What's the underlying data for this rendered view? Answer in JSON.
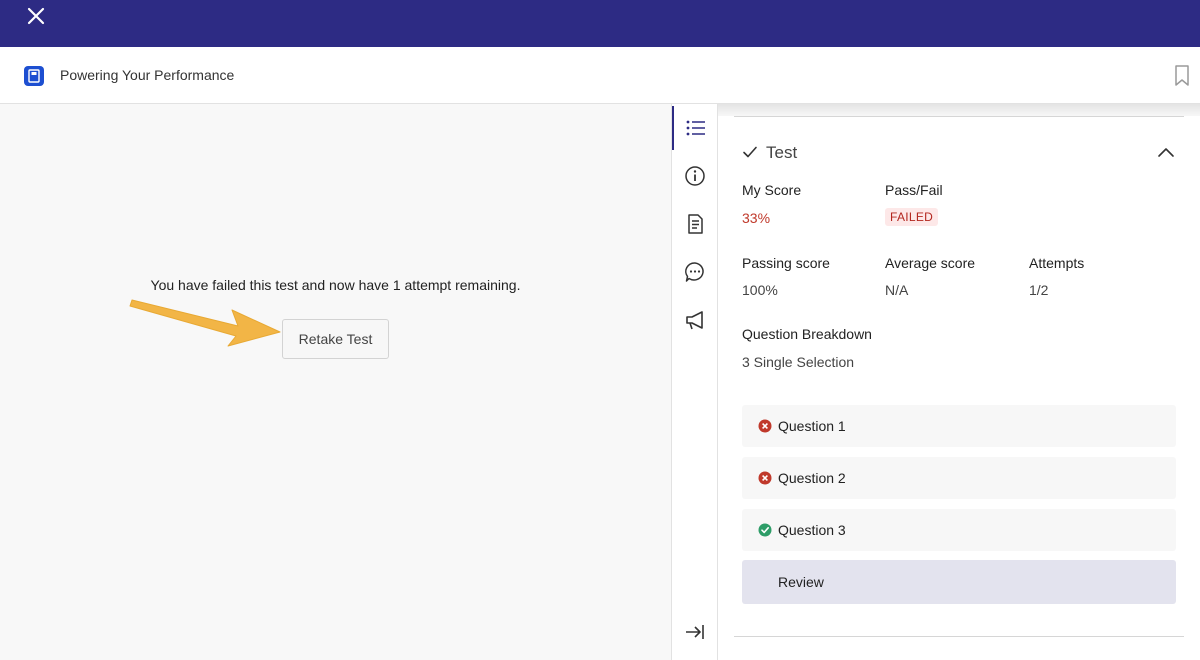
{
  "topbar": {
    "close_icon": "close-icon",
    "color": "#2d2b84"
  },
  "header": {
    "app_icon": "book-icon",
    "title": "Powering Your Performance",
    "bookmark_icon": "bookmark-icon"
  },
  "main": {
    "message": "You have failed this test and now have 1 attempt remaining.",
    "retake_label": "Retake Test",
    "arrow_color": "#f2b546"
  },
  "rail": {
    "items": [
      {
        "icon": "list-icon"
      },
      {
        "icon": "info-icon"
      },
      {
        "icon": "document-icon"
      },
      {
        "icon": "chat-icon"
      },
      {
        "icon": "megaphone-icon"
      }
    ],
    "collapse_icon": "collapse-panel-icon"
  },
  "panel": {
    "section_title": "Test",
    "my_score": {
      "label": "My Score",
      "value": "33%"
    },
    "pass_fail": {
      "label": "Pass/Fail",
      "value": "FAILED"
    },
    "passing_score": {
      "label": "Passing score",
      "value": "100%"
    },
    "average_score": {
      "label": "Average score",
      "value": "N/A"
    },
    "attempts": {
      "label": "Attempts",
      "value": "1/2"
    },
    "breakdown": {
      "label": "Question Breakdown",
      "value": "3 Single Selection"
    },
    "questions": [
      {
        "label": "Question 1",
        "status": "incorrect"
      },
      {
        "label": "Question 2",
        "status": "incorrect"
      },
      {
        "label": "Question 3",
        "status": "correct"
      }
    ],
    "review_label": "Review",
    "colors": {
      "fail": "#c0392b",
      "pass": "#2e9d68"
    }
  }
}
